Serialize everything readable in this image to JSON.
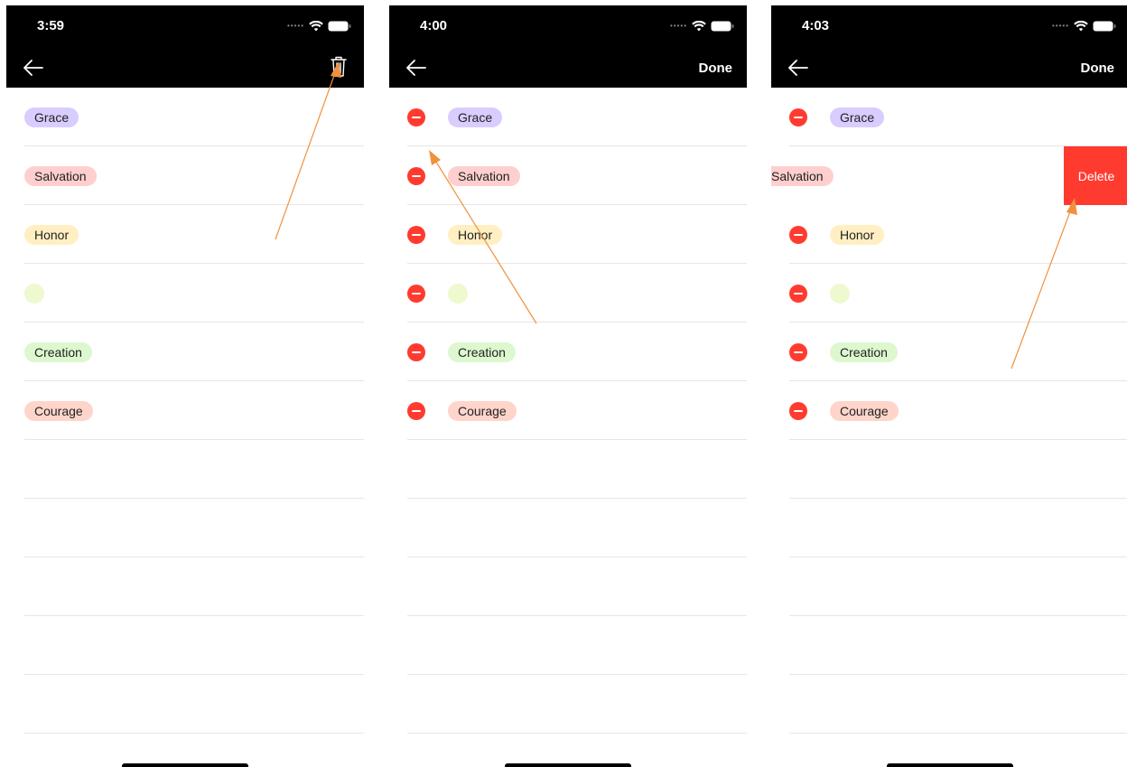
{
  "screens": [
    {
      "time": "3:59",
      "mode": "view",
      "tags": [
        {
          "label": "Grace",
          "color": "#d9ccff"
        },
        {
          "label": "Salvation",
          "color": "#ffcfcf"
        },
        {
          "label": "Honor",
          "color": "#ffefc2"
        },
        {
          "label": "",
          "color": "#eef9cf"
        },
        {
          "label": "Creation",
          "color": "#ddf7cf"
        },
        {
          "label": "Courage",
          "color": "#ffd5cb"
        }
      ]
    },
    {
      "time": "4:00",
      "mode": "edit",
      "done_label": "Done",
      "tags": [
        {
          "label": "Grace",
          "color": "#d9ccff"
        },
        {
          "label": "Salvation",
          "color": "#ffcfcf"
        },
        {
          "label": "Honor",
          "color": "#ffefc2"
        },
        {
          "label": "",
          "color": "#eef9cf"
        },
        {
          "label": "Creation",
          "color": "#ddf7cf"
        },
        {
          "label": "Courage",
          "color": "#ffd5cb"
        }
      ]
    },
    {
      "time": "4:03",
      "mode": "edit",
      "done_label": "Done",
      "delete_label": "Delete",
      "tags": [
        {
          "label": "Grace",
          "color": "#d9ccff"
        },
        {
          "label": "Salvation",
          "color": "#ffcfcf"
        },
        {
          "label": "Honor",
          "color": "#ffefc2"
        },
        {
          "label": "",
          "color": "#eef9cf"
        },
        {
          "label": "Creation",
          "color": "#ddf7cf"
        },
        {
          "label": "Courage",
          "color": "#ffd5cb"
        }
      ]
    }
  ],
  "colors": {
    "bar": "#000000",
    "destructive": "#ff3b30",
    "annotation_arrow": "#f0913e"
  }
}
